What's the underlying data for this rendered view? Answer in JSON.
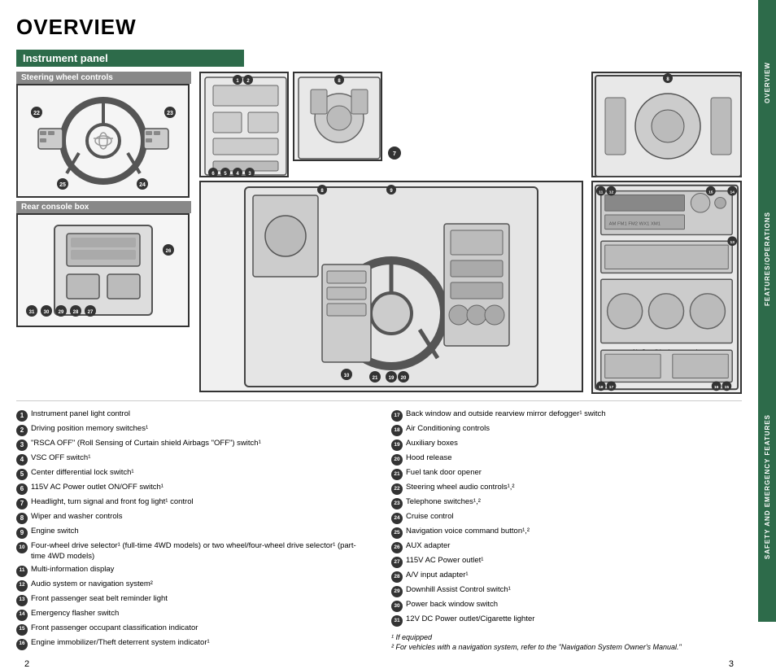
{
  "title": "OVERVIEW",
  "instrument_panel_label": "Instrument panel",
  "sections": {
    "steering_wheel": "Steering wheel controls",
    "rear_console": "Rear console box"
  },
  "sidebar_labels": [
    "OVERVIEW",
    "FEATURES/OPERATIONS",
    "SAFETY AND EMERGENCY FEATURES"
  ],
  "list_left": [
    {
      "num": "1",
      "text": "Instrument panel light control"
    },
    {
      "num": "2",
      "text": "Driving position memory switches¹"
    },
    {
      "num": "3",
      "text": "\"RSCA OFF\" (Roll Sensing of Curtain shield Airbags \"OFF\") switch¹"
    },
    {
      "num": "4",
      "text": "VSC OFF switch¹"
    },
    {
      "num": "5",
      "text": "Center differential lock switch¹"
    },
    {
      "num": "6",
      "text": "115V AC Power outlet ON/OFF switch¹"
    },
    {
      "num": "7",
      "text": "Headlight, turn signal and front fog light¹ control"
    },
    {
      "num": "8",
      "text": "Wiper and washer controls"
    },
    {
      "num": "9",
      "text": "Engine switch"
    },
    {
      "num": "10",
      "text": "Four-wheel drive selector¹ (full-time 4WD models) or two wheel/four-wheel drive selector¹ (part-time 4WD models)"
    },
    {
      "num": "11",
      "text": "Multi-information display"
    },
    {
      "num": "12",
      "text": "Audio system or navigation system²"
    },
    {
      "num": "13",
      "text": "Front passenger seat belt reminder light"
    },
    {
      "num": "14",
      "text": "Emergency flasher switch"
    },
    {
      "num": "15",
      "text": "Front passenger occupant classification indicator"
    },
    {
      "num": "16",
      "text": "Engine immobilizer/Theft deterrent system indicator¹"
    }
  ],
  "list_right": [
    {
      "num": "17",
      "text": "Back window and outside rearview mirror defogger¹ switch"
    },
    {
      "num": "18",
      "text": "Air Conditioning controls"
    },
    {
      "num": "19",
      "text": "Auxiliary boxes"
    },
    {
      "num": "20",
      "text": "Hood release"
    },
    {
      "num": "21",
      "text": "Fuel tank door opener"
    },
    {
      "num": "22",
      "text": "Steering wheel audio controls¹,²"
    },
    {
      "num": "23",
      "text": "Telephone switches¹,²"
    },
    {
      "num": "24",
      "text": "Cruise control"
    },
    {
      "num": "25",
      "text": "Navigation voice command button¹,²"
    },
    {
      "num": "26",
      "text": "AUX adapter"
    },
    {
      "num": "27",
      "text": "115V AC Power outlet¹"
    },
    {
      "num": "28",
      "text": "A/V input adapter¹"
    },
    {
      "num": "29",
      "text": "Downhill Assist Control switch¹"
    },
    {
      "num": "30",
      "text": "Power back window switch"
    },
    {
      "num": "31",
      "text": "12V DC Power outlet/Cigarette lighter"
    }
  ],
  "footnotes": [
    "¹ If equipped",
    "² For vehicles with a navigation system, refer to the \"Navigation System Owner's Manual.\""
  ],
  "pages": {
    "left": "2",
    "right": "3"
  }
}
